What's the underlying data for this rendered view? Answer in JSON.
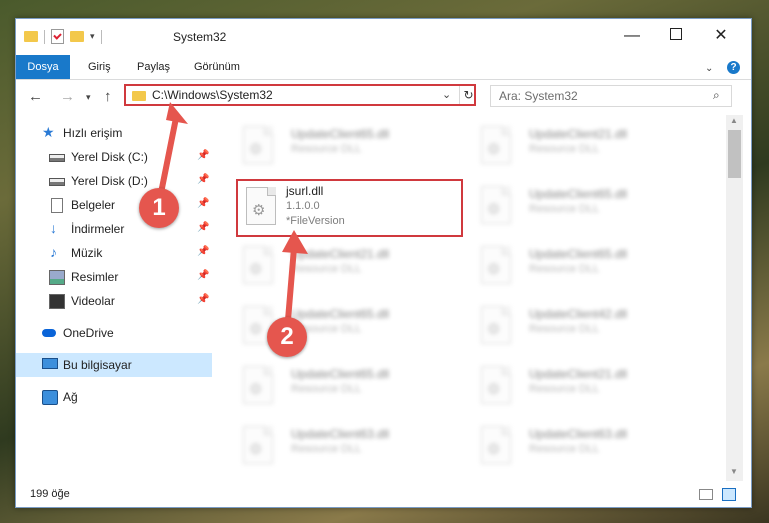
{
  "window": {
    "title": "System32"
  },
  "ribbon": {
    "tabs": [
      {
        "label": "Dosya"
      },
      {
        "label": "Giriş"
      },
      {
        "label": "Paylaş"
      },
      {
        "label": "Görünüm"
      }
    ],
    "help_label": "?"
  },
  "nav": {
    "address_path": "C:\\Windows\\System32",
    "search_placeholder": "Ara: System32"
  },
  "sidebar": {
    "items": [
      {
        "label": "Hızlı erişim",
        "icon": "star-icon"
      },
      {
        "label": "Yerel Disk (C:)",
        "icon": "drive-icon",
        "pinned": true
      },
      {
        "label": "Yerel Disk (D:)",
        "icon": "drive-icon",
        "pinned": true
      },
      {
        "label": "Belgeler",
        "icon": "documents-icon",
        "pinned": true
      },
      {
        "label": "İndirmeler",
        "icon": "download-icon",
        "pinned": true
      },
      {
        "label": "Müzik",
        "icon": "music-icon",
        "pinned": true
      },
      {
        "label": "Resimler",
        "icon": "pictures-icon",
        "pinned": true
      },
      {
        "label": "Videolar",
        "icon": "videos-icon",
        "pinned": true
      },
      {
        "label": "OneDrive",
        "icon": "cloud-icon"
      },
      {
        "label": "Bu bilgisayar",
        "icon": "computer-icon",
        "selected": true
      },
      {
        "label": "Ağ",
        "icon": "network-icon"
      }
    ]
  },
  "files": {
    "items": [
      {
        "name": "UpdateClient65.dll",
        "type": "Resource DLL"
      },
      {
        "name": "UpdateClient21.dll",
        "type": "Resource DLL"
      },
      {
        "name": "jsurl.dll",
        "version": "1.1.0.0",
        "type": "*FileVersion",
        "highlighted": true
      },
      {
        "name": "UpdateClient65.dll",
        "type": "Resource DLL"
      },
      {
        "name": "UpdateClient21.dll",
        "type": "Resource DLL"
      },
      {
        "name": "UpdateClient65.dll",
        "type": "Resource DLL"
      },
      {
        "name": "UpdateClient65.dll",
        "type": "Resource DLL"
      },
      {
        "name": "UpdateClient42.dll",
        "type": "Resource DLL"
      },
      {
        "name": "UpdateClient65.dll",
        "type": "Resource DLL"
      },
      {
        "name": "UpdateClient21.dll",
        "type": "Resource DLL"
      },
      {
        "name": "UpdateClient63.dll",
        "type": "Resource DLL"
      },
      {
        "name": "UpdateClient63.dll",
        "type": "Resource DLL"
      }
    ]
  },
  "status": {
    "item_count": "199 öğe"
  },
  "annotations": {
    "step1": "1",
    "step2": "2",
    "color": "#e5564e",
    "highlight_color": "#d0393e"
  },
  "colors": {
    "accent": "#1979ca",
    "selected_bg": "#cce8ff"
  }
}
